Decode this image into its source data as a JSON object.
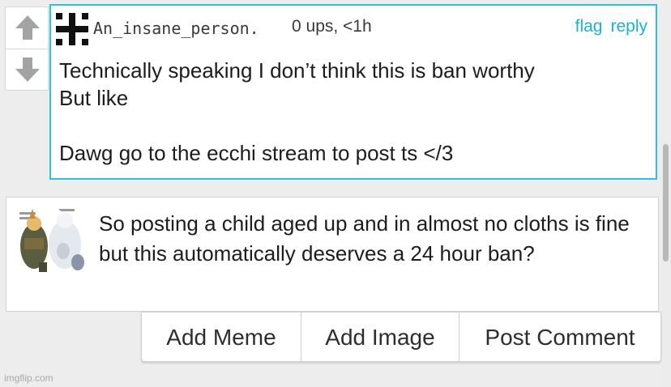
{
  "vote": {
    "up_icon": "upvote-arrow-icon",
    "down_icon": "downvote-arrow-icon",
    "arrow_color": "#9e9e9e"
  },
  "comment": {
    "avatar_icon": "cross-pattern-avatar",
    "username": "An_insane_person.",
    "meta": "0 ups, <1h",
    "flag_label": "flag",
    "reply_label": "reply",
    "text": "Technically speaking I don’t think this is ban worthy\nBut like\n\nDawg go to the ecchi stream to post ts </3",
    "border_color": "#2fc0e6",
    "link_color": "#16b2dd"
  },
  "compose": {
    "attachment": "attached-image-thumbnail",
    "text": "So posting a child aged up and in almost no cloths is fine but this automatically deserves a 24 hour ban?"
  },
  "buttons": {
    "add_meme": "Add Meme",
    "add_image": "Add Image",
    "post_comment": "Post Comment"
  },
  "watermark": "imgflip.com"
}
